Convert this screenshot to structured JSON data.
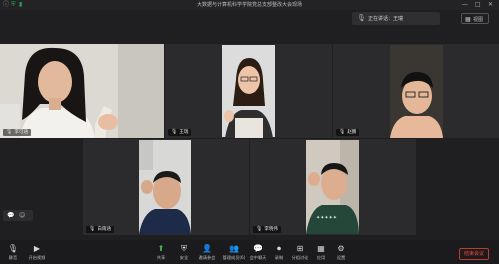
{
  "window": {
    "title": "大数据与计算机科学学院党总支部整改大会现场"
  },
  "speaking": {
    "label": "正在讲话：王瑞"
  },
  "view": {
    "label": "视图"
  },
  "tiles": [
    {
      "name": "李可涵"
    },
    {
      "name": "王瑞"
    },
    {
      "name": "赵鹏"
    },
    {
      "name": "白雨涵"
    },
    {
      "name": "李晓伟"
    }
  ],
  "toolbar": {
    "items": [
      {
        "label": "静音",
        "icon": "mic-icon"
      },
      {
        "label": "开启视频",
        "icon": "video-icon"
      },
      {
        "label": "共享",
        "icon": "share-icon"
      },
      {
        "label": "安全",
        "icon": "shield-icon"
      },
      {
        "label": "邀请参会",
        "icon": "invite-icon"
      },
      {
        "label": "管理成员(6)",
        "icon": "members-icon"
      },
      {
        "label": "会中聊天",
        "icon": "chat-icon"
      },
      {
        "label": "录制",
        "icon": "record-icon"
      },
      {
        "label": "分组讨论",
        "icon": "breakout-icon"
      },
      {
        "label": "应用",
        "icon": "apps-icon"
      },
      {
        "label": "设置",
        "icon": "settings-icon"
      }
    ],
    "end_label": "结束会议"
  }
}
